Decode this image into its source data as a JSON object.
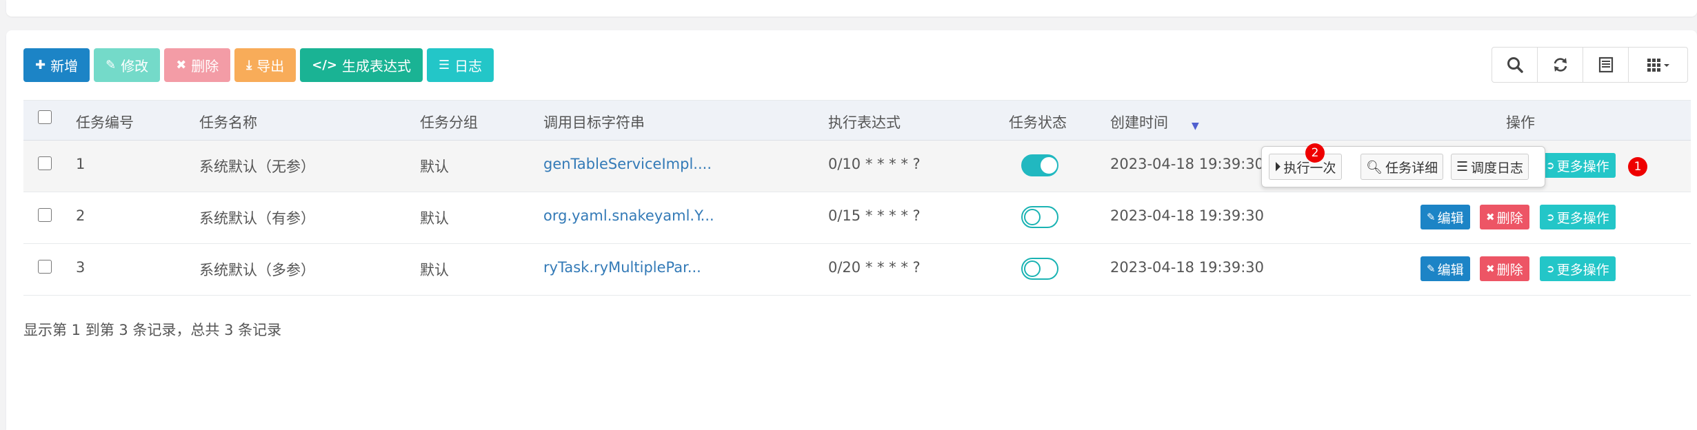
{
  "toolbar": {
    "add": "新增",
    "edit": "修改",
    "delete": "删除",
    "export": "导出",
    "expression": "生成表达式",
    "log": "日志"
  },
  "table": {
    "headers": {
      "id": "任务编号",
      "name": "任务名称",
      "group": "任务分组",
      "target": "调用目标字符串",
      "cron": "执行表达式",
      "status": "任务状态",
      "created": "创建时间",
      "actions": "操作"
    },
    "rows": [
      {
        "id": "1",
        "name": "系统默认（无参）",
        "group": "默认",
        "target": "genTableServiceImpl....",
        "cron": "0/10 * * * * ?",
        "status_on": true,
        "created": "2023-04-18 19:39:30"
      },
      {
        "id": "2",
        "name": "系统默认（有参）",
        "group": "默认",
        "target": "org.yaml.snakeyaml.Y...",
        "cron": "0/15 * * * * ?",
        "status_on": false,
        "created": "2023-04-18 19:39:30"
      },
      {
        "id": "3",
        "name": "系统默认（多参）",
        "group": "默认",
        "target": "ryTask.ryMultiplePar...",
        "cron": "0/20 * * * * ?",
        "status_on": false,
        "created": "2023-04-18 19:39:30"
      }
    ],
    "action_labels": {
      "edit": "编辑",
      "delete": "删除",
      "more": "更多操作"
    }
  },
  "popover": {
    "run_once": "执行一次",
    "detail": "任务详细",
    "schedule_log": "调度日志"
  },
  "badges": {
    "more_ops": "1",
    "run_once": "2"
  },
  "pagination": {
    "summary": "显示第 1 到第 3 条记录，总共 3 条记录"
  },
  "colors": {
    "primary": "#1c84c6",
    "success": "#1ab394",
    "info": "#23c6c8",
    "warning": "#f8ac59",
    "danger": "#ed5565"
  },
  "icons": {
    "right_tools": [
      "search-icon",
      "refresh-icon",
      "toggle-view-icon",
      "columns-icon"
    ]
  }
}
